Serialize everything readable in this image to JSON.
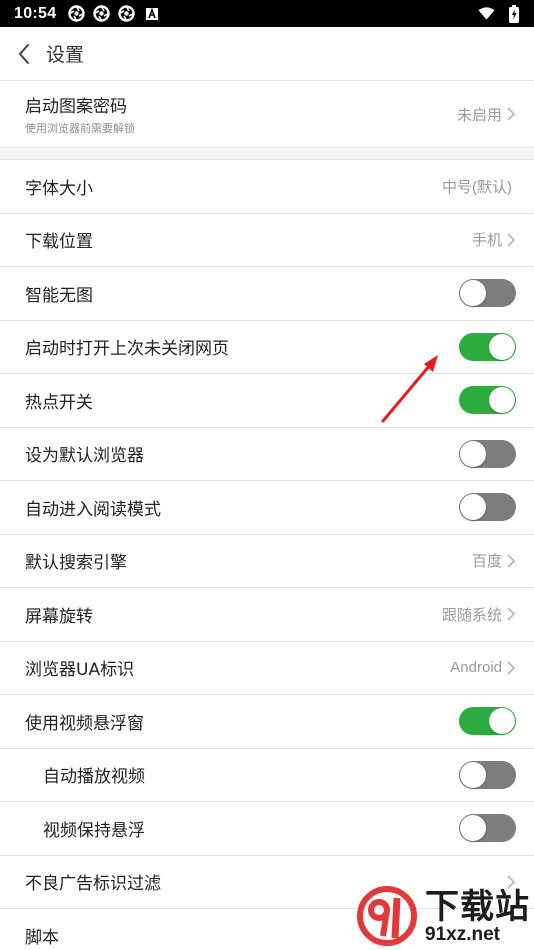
{
  "status": {
    "time": "10:54"
  },
  "header": {
    "title": "设置"
  },
  "pattern": {
    "label": "启动图案密码",
    "sublabel": "使用浏览器前需要解锁",
    "value": "未启用"
  },
  "rows": [
    {
      "label": "字体大小",
      "value": "中号(默认)"
    },
    {
      "label": "下载位置",
      "value": "手机"
    },
    {
      "label": "智能无图",
      "toggle": "off"
    },
    {
      "label": "启动时打开上次未关闭网页",
      "toggle": "on"
    },
    {
      "label": "热点开关",
      "toggle": "on"
    },
    {
      "label": "设为默认浏览器",
      "toggle": "off"
    },
    {
      "label": "自动进入阅读模式",
      "toggle": "off"
    },
    {
      "label": "默认搜索引擎",
      "value": "百度"
    },
    {
      "label": "屏幕旋转",
      "value": "跟随系统"
    },
    {
      "label": "浏览器UA标识",
      "value": "Android"
    },
    {
      "label": "使用视频悬浮窗",
      "toggle": "on"
    },
    {
      "label": "自动播放视频",
      "toggle": "off"
    },
    {
      "label": "视频保持悬浮",
      "toggle": "off"
    },
    {
      "label": "不良广告标识过滤"
    },
    {
      "label": "脚本"
    }
  ],
  "watermark": {
    "title": "下载站",
    "domain": "91xz.net"
  },
  "colors": {
    "toggle_on": "#2cab3f",
    "toggle_off": "#7d7d7d",
    "arrow": "#e31c1c"
  }
}
